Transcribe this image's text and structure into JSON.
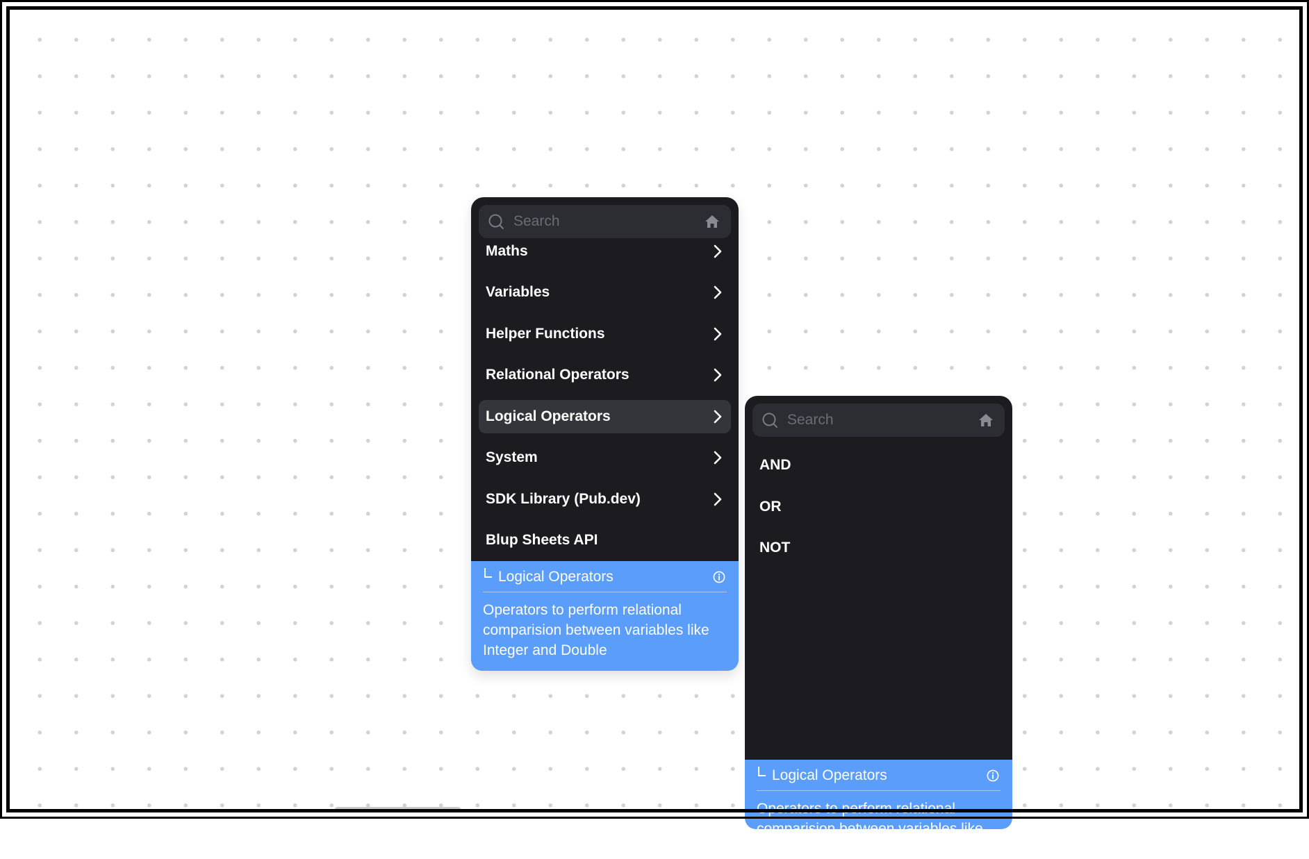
{
  "main_menu": {
    "search": {
      "placeholder": "Search",
      "value": ""
    },
    "items": [
      {
        "label": "Maths",
        "has_submenu": true,
        "active": false
      },
      {
        "label": "Variables",
        "has_submenu": true,
        "active": false
      },
      {
        "label": "Helper Functions",
        "has_submenu": true,
        "active": false
      },
      {
        "label": "Relational Operators",
        "has_submenu": true,
        "active": false
      },
      {
        "label": "Logical Operators",
        "has_submenu": true,
        "active": true
      },
      {
        "label": "System",
        "has_submenu": true,
        "active": false
      },
      {
        "label": "SDK Library (Pub.dev)",
        "has_submenu": true,
        "active": false
      },
      {
        "label": "Blup Sheets API",
        "has_submenu": false,
        "active": false
      }
    ],
    "info": {
      "title": "Logical Operators",
      "description": "Operators to perform relational comparision between variables like Integer and Double"
    }
  },
  "sub_menu": {
    "search": {
      "placeholder": "Search",
      "value": ""
    },
    "items": [
      {
        "label": "AND"
      },
      {
        "label": "OR"
      },
      {
        "label": "NOT"
      }
    ],
    "info": {
      "title": "Logical Operators",
      "description": "Operators to perform relational comparision between variables like Integer and Double"
    }
  },
  "colors": {
    "panel_bg": "#1b1b20",
    "search_bg": "#2c2c33",
    "active_item_bg": "#34343b",
    "info_card_bg": "#5a9dfa",
    "canvas_dot": "#d2d2d6"
  },
  "icons": [
    "search-icon",
    "home-icon",
    "chevron-right-icon",
    "info-icon"
  ]
}
